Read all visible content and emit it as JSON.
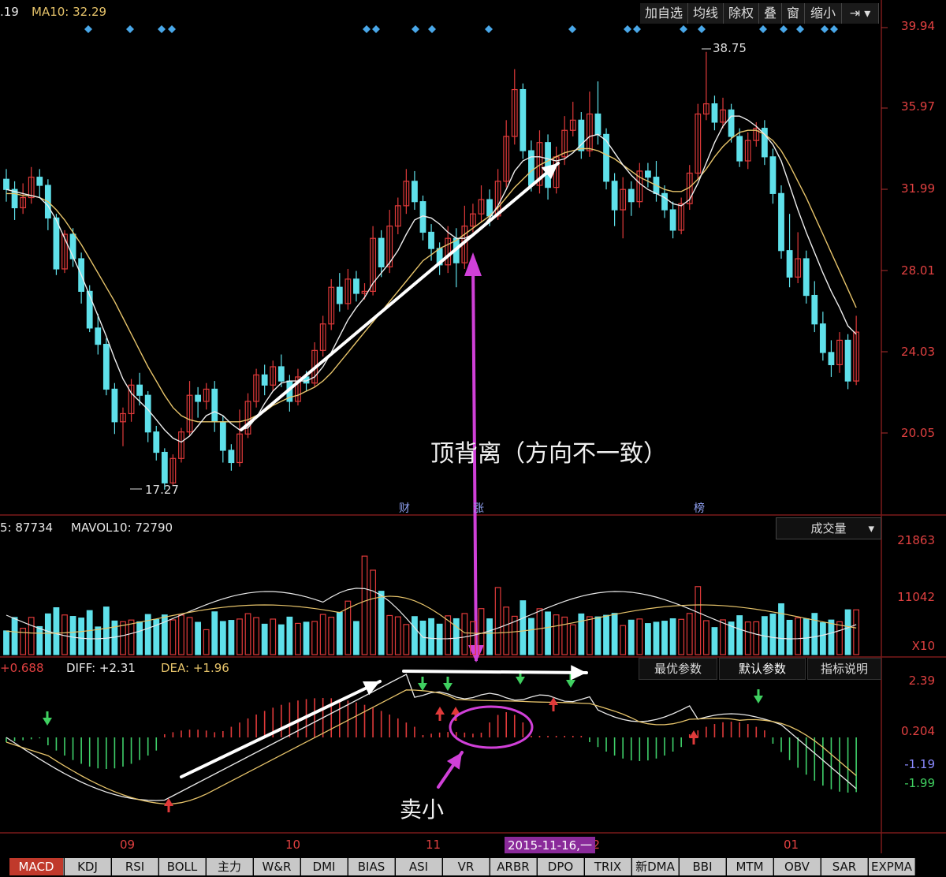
{
  "header": {
    "ma5_label": ".19",
    "ma10_label": "MA10: 32.29",
    "volume_label": "5: 87734",
    "mavol10_label": "MAVOL10: 72790",
    "macd_label": "+0.688",
    "diff_label": "DIFF: +2.31",
    "dea_label": "DEA: +1.96"
  },
  "toolbar": [
    "加自选",
    "均线",
    "除权",
    "叠",
    "窗",
    "缩小"
  ],
  "price_axis": [
    "39.94",
    "35.97",
    "31.99",
    "28.01",
    "24.03",
    "20.05"
  ],
  "volume_axis": [
    "21863",
    "11042",
    "X10"
  ],
  "macd_axis": [
    "2.39",
    "0.204",
    "-1.19",
    "-1.99"
  ],
  "volume_select": "成交量",
  "macd_buttons": [
    "最优参数",
    "默认参数",
    "指标说明"
  ],
  "price_marks": {
    "high": "38.75",
    "low": "17.27"
  },
  "event_marks": [
    "财",
    "涨",
    "榜"
  ],
  "annotations": {
    "top_divergence": "顶背离（方向不一致）",
    "sell_small": "卖小"
  },
  "x_axis": [
    "09",
    "10",
    "11",
    "12",
    "01"
  ],
  "date_badge": "2015-11-16,一",
  "tabs": [
    "MACD",
    "KDJ",
    "RSI",
    "BOLL",
    "主力",
    "W&R",
    "DMI",
    "BIAS",
    "ASI",
    "VR",
    "ARBR",
    "DPO",
    "TRIX",
    "新DMA",
    "BBI",
    "MTM",
    "OBV",
    "SAR",
    "EXPMA"
  ],
  "colors": {
    "up": "#e03a3a",
    "down": "#5fe0ea",
    "ma_white": "#ececec",
    "ma_yellow": "#e6c36a",
    "arrow_magenta": "#d040d8"
  },
  "chart_data": {
    "type": "candlestick",
    "price_ylim": [
      16,
      41
    ],
    "candles": [
      [
        32.5,
        32.0,
        33.0,
        31.4
      ],
      [
        32.0,
        31.1,
        32.4,
        30.5
      ],
      [
        31.1,
        31.6,
        32.3,
        30.8
      ],
      [
        31.6,
        32.6,
        33.1,
        31.3
      ],
      [
        32.6,
        32.2,
        33.0,
        31.6
      ],
      [
        32.2,
        30.6,
        32.5,
        30.0
      ],
      [
        30.6,
        28.1,
        30.8,
        27.8
      ],
      [
        28.1,
        29.8,
        30.0,
        27.9
      ],
      [
        29.8,
        28.6,
        30.1,
        28.2
      ],
      [
        28.6,
        27.0,
        28.9,
        26.4
      ],
      [
        27.0,
        25.2,
        27.3,
        25.0
      ],
      [
        25.2,
        24.4,
        25.9,
        23.9
      ],
      [
        24.4,
        22.2,
        24.7,
        21.9
      ],
      [
        22.2,
        20.6,
        22.5,
        20.0
      ],
      [
        20.6,
        21.0,
        21.3,
        19.4
      ],
      [
        21.0,
        22.4,
        22.7,
        20.6
      ],
      [
        22.4,
        21.9,
        23.0,
        21.4
      ],
      [
        21.9,
        20.1,
        22.1,
        19.6
      ],
      [
        20.1,
        19.1,
        20.4,
        18.7
      ],
      [
        19.1,
        17.6,
        19.3,
        17.27
      ],
      [
        17.6,
        18.8,
        19.0,
        17.5
      ],
      [
        18.8,
        20.1,
        20.3,
        18.6
      ],
      [
        20.1,
        21.9,
        22.6,
        19.9
      ],
      [
        21.9,
        21.6,
        22.3,
        20.8
      ],
      [
        21.6,
        22.2,
        22.5,
        21.2
      ],
      [
        22.2,
        20.6,
        22.6,
        20.1
      ],
      [
        20.6,
        19.2,
        20.9,
        18.6
      ],
      [
        19.2,
        18.6,
        19.5,
        18.2
      ],
      [
        18.6,
        20.0,
        21.2,
        18.4
      ],
      [
        20.0,
        21.6,
        22.0,
        19.8
      ],
      [
        21.6,
        22.9,
        23.2,
        21.3
      ],
      [
        22.9,
        22.4,
        23.4,
        21.9
      ],
      [
        22.4,
        23.3,
        23.6,
        22.1
      ],
      [
        23.3,
        22.6,
        23.9,
        22.3
      ],
      [
        22.6,
        21.6,
        22.9,
        21.1
      ],
      [
        21.6,
        22.8,
        23.2,
        21.4
      ],
      [
        22.8,
        22.5,
        23.1,
        22.1
      ],
      [
        22.5,
        24.1,
        24.5,
        22.3
      ],
      [
        24.1,
        25.4,
        25.8,
        23.8
      ],
      [
        25.4,
        27.2,
        27.6,
        25.1
      ],
      [
        27.2,
        26.4,
        27.9,
        26.0
      ],
      [
        26.4,
        27.6,
        28.1,
        26.1
      ],
      [
        27.6,
        26.9,
        28.0,
        26.5
      ],
      [
        26.9,
        27.0,
        27.4,
        26.6
      ],
      [
        27.0,
        29.6,
        30.2,
        26.8
      ],
      [
        29.6,
        28.2,
        30.0,
        27.7
      ],
      [
        28.2,
        30.2,
        31.0,
        27.9
      ],
      [
        30.2,
        31.2,
        31.6,
        29.8
      ],
      [
        31.2,
        32.4,
        33.0,
        30.8
      ],
      [
        32.4,
        31.4,
        32.9,
        31.0
      ],
      [
        31.4,
        29.9,
        31.7,
        29.5
      ],
      [
        29.9,
        29.1,
        30.3,
        28.5
      ],
      [
        29.1,
        28.3,
        29.4,
        27.8
      ],
      [
        28.3,
        29.6,
        30.2,
        27.9
      ],
      [
        29.6,
        28.4,
        30.1,
        27.2
      ],
      [
        28.4,
        30.2,
        31.2,
        28.1
      ],
      [
        30.2,
        30.8,
        31.3,
        29.9
      ],
      [
        30.8,
        31.5,
        32.2,
        30.4
      ],
      [
        31.5,
        30.7,
        32.0,
        30.2
      ],
      [
        30.7,
        32.4,
        33.0,
        30.5
      ],
      [
        32.4,
        34.6,
        35.4,
        32.1
      ],
      [
        34.6,
        36.9,
        37.9,
        34.2
      ],
      [
        36.9,
        33.9,
        37.2,
        33.5
      ],
      [
        33.9,
        32.2,
        34.4,
        31.9
      ],
      [
        32.2,
        34.3,
        34.9,
        31.8
      ],
      [
        34.3,
        32.1,
        34.7,
        31.5
      ],
      [
        32.1,
        33.6,
        34.1,
        31.8
      ],
      [
        33.6,
        34.9,
        35.6,
        33.2
      ],
      [
        34.9,
        35.4,
        36.3,
        34.6
      ],
      [
        35.4,
        33.9,
        35.8,
        33.5
      ],
      [
        33.9,
        35.7,
        36.8,
        33.6
      ],
      [
        35.7,
        34.7,
        37.3,
        34.2
      ],
      [
        34.7,
        32.4,
        35.0,
        32.0
      ],
      [
        32.4,
        31.0,
        32.8,
        30.2
      ],
      [
        31.0,
        32.0,
        32.6,
        29.6
      ],
      [
        32.0,
        31.4,
        32.4,
        30.7
      ],
      [
        31.4,
        32.9,
        33.3,
        31.1
      ],
      [
        32.9,
        32.6,
        33.3,
        32.1
      ],
      [
        32.6,
        31.8,
        33.4,
        31.4
      ],
      [
        31.8,
        31.0,
        32.2,
        30.6
      ],
      [
        31.0,
        30.0,
        31.4,
        29.6
      ],
      [
        30.0,
        31.3,
        31.6,
        29.8
      ],
      [
        31.3,
        32.8,
        33.2,
        31.0
      ],
      [
        32.8,
        35.7,
        36.2,
        32.5
      ],
      [
        35.7,
        36.2,
        38.75,
        35.4
      ],
      [
        36.2,
        35.3,
        36.6,
        34.9
      ],
      [
        35.3,
        35.9,
        36.5,
        35.0
      ],
      [
        35.9,
        34.6,
        36.2,
        34.3
      ],
      [
        34.6,
        33.4,
        35.0,
        33.1
      ],
      [
        33.4,
        34.4,
        34.8,
        33.0
      ],
      [
        34.4,
        35.0,
        35.3,
        34.1
      ],
      [
        35.0,
        33.6,
        35.4,
        33.2
      ],
      [
        33.6,
        31.8,
        34.0,
        31.3
      ],
      [
        31.8,
        29.0,
        32.2,
        28.6
      ],
      [
        29.0,
        27.7,
        30.8,
        27.2
      ],
      [
        27.7,
        28.6,
        29.9,
        27.4
      ],
      [
        28.6,
        26.8,
        29.0,
        26.4
      ],
      [
        26.8,
        25.4,
        27.5,
        25.0
      ],
      [
        25.4,
        24.0,
        26.0,
        23.6
      ],
      [
        24.0,
        23.4,
        24.6,
        22.8
      ],
      [
        23.4,
        24.6,
        25.0,
        23.0
      ],
      [
        24.6,
        22.6,
        24.9,
        22.2
      ],
      [
        22.6,
        25.0,
        25.8,
        22.4
      ]
    ],
    "ma5": [
      32.0,
      31.9,
      31.8,
      31.7,
      31.6,
      31.2,
      30.5,
      29.6,
      28.7,
      27.8,
      26.8,
      25.8,
      24.8,
      23.7,
      22.7,
      22.0,
      21.6,
      21.2,
      20.7,
      20.2,
      19.8,
      19.6,
      19.9,
      20.4,
      20.9,
      21.1,
      20.9,
      20.5,
      20.2,
      20.3,
      20.8,
      21.5,
      22.1,
      22.5,
      22.6,
      22.6,
      22.6,
      22.8,
      23.3,
      24.0,
      24.8,
      25.6,
      26.2,
      26.7,
      27.4,
      27.9,
      28.4,
      29.0,
      29.8,
      30.5,
      30.7,
      30.6,
      30.3,
      29.9,
      29.6,
      29.6,
      29.8,
      30.1,
      30.6,
      31.2,
      32.0,
      32.9,
      33.4,
      33.6,
      33.6,
      33.5,
      33.4,
      33.5,
      33.8,
      34.2,
      34.6,
      34.7,
      34.4,
      33.8,
      33.2,
      32.7,
      32.3,
      32.0,
      31.8,
      31.6,
      31.3,
      31.2,
      31.5,
      32.3,
      33.3,
      34.3,
      35.1,
      35.6,
      35.6,
      35.4,
      35.1,
      34.7,
      34.2,
      33.4,
      32.2,
      31.0,
      29.9,
      28.9,
      27.9,
      27.0,
      26.2,
      25.3,
      24.9
    ],
    "ma10": [
      31.8,
      31.8,
      31.7,
      31.7,
      31.6,
      31.4,
      31.0,
      30.5,
      29.9,
      29.3,
      28.6,
      27.9,
      27.2,
      26.5,
      25.7,
      24.9,
      24.1,
      23.3,
      22.6,
      21.9,
      21.3,
      20.9,
      20.7,
      20.6,
      20.6,
      20.6,
      20.6,
      20.6,
      20.6,
      20.7,
      20.9,
      21.1,
      21.4,
      21.6,
      21.8,
      21.9,
      22.1,
      22.3,
      22.6,
      23.0,
      23.5,
      24.0,
      24.5,
      25.0,
      25.5,
      26.0,
      26.5,
      27.0,
      27.5,
      28.0,
      28.5,
      28.8,
      29.1,
      29.3,
      29.5,
      29.8,
      30.1,
      30.4,
      30.7,
      31.1,
      31.6,
      32.1,
      32.5,
      32.9,
      33.2,
      33.4,
      33.6,
      33.8,
      33.9,
      34.0,
      34.0,
      33.9,
      33.7,
      33.5,
      33.2,
      32.9,
      32.6,
      32.4,
      32.2,
      32.0,
      31.9,
      31.9,
      32.1,
      32.5,
      33.0,
      33.6,
      34.1,
      34.5,
      34.8,
      34.9,
      34.9,
      34.7,
      34.4,
      33.9,
      33.2,
      32.4,
      31.6,
      30.7,
      29.8,
      28.9,
      28.0,
      27.1,
      26.2
    ]
  }
}
